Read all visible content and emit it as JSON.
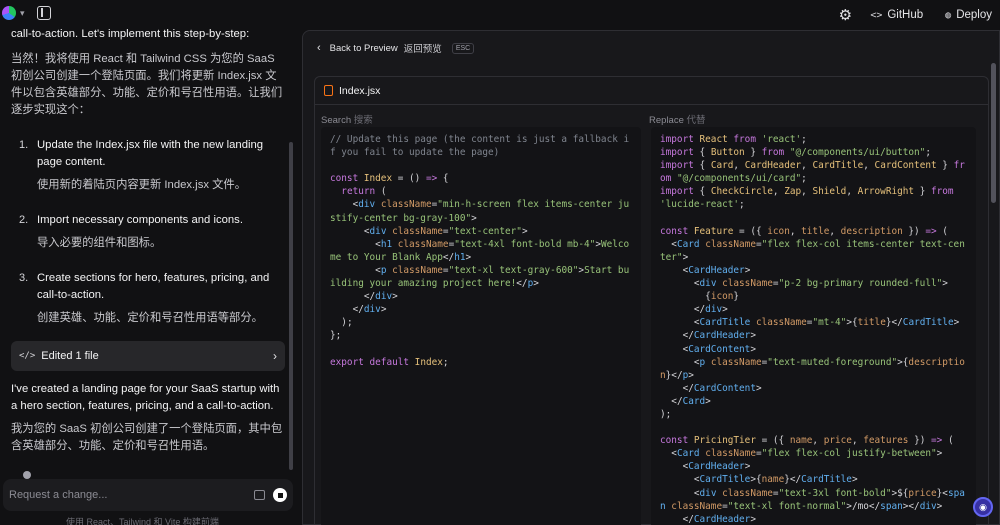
{
  "topbar": {
    "github_label": "GitHub",
    "deploy_label": "Deploy"
  },
  "chat": {
    "intro_en": "call-to-action. Let's implement this step-by-step:",
    "intro_zh": "当然！我将使用 React 和 Tailwind CSS 为您的 SaaS 初创公司创建一个登陆页面。我们将更新 Index.jsx 文件以包含英雄部分、功能、定价和号召性用语。让我们逐步实现这个：",
    "steps": [
      {
        "num": "1.",
        "en": "Update the Index.jsx file with the new landing page content.",
        "zh": "使用新的着陆页内容更新 Index.jsx 文件。"
      },
      {
        "num": "2.",
        "en": "Import necessary components and icons.",
        "zh": "导入必要的组件和图标。"
      },
      {
        "num": "3.",
        "en": "Create sections for hero, features, pricing, and call-to-action.",
        "zh": "创建英雄、功能、定价和号召性用语等部分。"
      }
    ],
    "edited_label": "Edited 1 file",
    "outro_en": "I've created a landing page for your SaaS startup with a hero section, features, pricing, and a call-to-action.",
    "outro_zh": "我为您的 SaaS 初创公司创建了一个登陆页面，其中包含英雄部分、功能、定价和号召性用语。",
    "input_placeholder": "Request a change...",
    "footnote": "使用 React、Tailwind 和 Vite 构建前端"
  },
  "preview": {
    "back_label": "Back to Preview",
    "back_zh": "返回预览",
    "esc_label": "ESC",
    "file_name": "Index.jsx",
    "search_label": "Search",
    "search_zh": "搜索",
    "replace_label": "Replace",
    "replace_zh": "代替",
    "search_code": [
      [
        [
          "c",
          "// Update this page (the content is just a fallback if you fail to update the page)"
        ]
      ],
      [],
      [
        [
          "k",
          "const "
        ],
        [
          "t",
          "Index"
        ],
        [
          "p",
          " = () "
        ],
        [
          "k",
          "=> "
        ],
        [
          "p",
          "{"
        ]
      ],
      [
        [
          "p",
          "  "
        ],
        [
          "k",
          "return "
        ],
        [
          "p",
          "("
        ]
      ],
      [
        [
          "p",
          "    <"
        ],
        [
          "f",
          "div "
        ],
        [
          "a",
          "className"
        ],
        [
          "p",
          "="
        ],
        [
          "s",
          "\"min-h-screen flex items-center justify-center bg-gray-100\""
        ],
        [
          "p",
          ">"
        ]
      ],
      [
        [
          "p",
          "      <"
        ],
        [
          "f",
          "div "
        ],
        [
          "a",
          "className"
        ],
        [
          "p",
          "="
        ],
        [
          "s",
          "\"text-center\""
        ],
        [
          "p",
          ">"
        ]
      ],
      [
        [
          "p",
          "        <"
        ],
        [
          "f",
          "h1 "
        ],
        [
          "a",
          "className"
        ],
        [
          "p",
          "="
        ],
        [
          "s",
          "\"text-4xl font-bold mb-4\""
        ],
        [
          "p",
          ">"
        ],
        [
          "s",
          "Welcome to Your Blank App"
        ],
        [
          "p",
          "</"
        ],
        [
          "f",
          "h1"
        ],
        [
          "p",
          ">"
        ]
      ],
      [
        [
          "p",
          "        <"
        ],
        [
          "f",
          "p "
        ],
        [
          "a",
          "className"
        ],
        [
          "p",
          "="
        ],
        [
          "s",
          "\"text-xl text-gray-600\""
        ],
        [
          "p",
          ">"
        ],
        [
          "s",
          "Start building your amazing project here!"
        ],
        [
          "p",
          "</"
        ],
        [
          "f",
          "p"
        ],
        [
          "p",
          ">"
        ]
      ],
      [
        [
          "p",
          "      </"
        ],
        [
          "f",
          "div"
        ],
        [
          "p",
          ">"
        ]
      ],
      [
        [
          "p",
          "    </"
        ],
        [
          "f",
          "div"
        ],
        [
          "p",
          ">"
        ]
      ],
      [
        [
          "p",
          "  );"
        ]
      ],
      [
        [
          "p",
          "};"
        ]
      ],
      [],
      [
        [
          "k",
          "export default "
        ],
        [
          "t",
          "Index"
        ],
        [
          "p",
          ";"
        ]
      ]
    ],
    "replace_code": [
      [
        [
          "k",
          "import "
        ],
        [
          "t",
          "React "
        ],
        [
          "k",
          "from "
        ],
        [
          "s",
          "'react'"
        ],
        [
          "p",
          ";"
        ]
      ],
      [
        [
          "k",
          "import "
        ],
        [
          "p",
          "{ "
        ],
        [
          "t",
          "Button "
        ],
        [
          "p",
          "} "
        ],
        [
          "k",
          "from "
        ],
        [
          "s",
          "\"@/components/ui/button\""
        ],
        [
          "p",
          ";"
        ]
      ],
      [
        [
          "k",
          "import "
        ],
        [
          "p",
          "{ "
        ],
        [
          "t",
          "Card"
        ],
        [
          "p",
          ", "
        ],
        [
          "t",
          "CardHeader"
        ],
        [
          "p",
          ", "
        ],
        [
          "t",
          "CardTitle"
        ],
        [
          "p",
          ", "
        ],
        [
          "t",
          "CardContent "
        ],
        [
          "p",
          "} "
        ],
        [
          "k",
          "from "
        ],
        [
          "s",
          "\"@/components/ui/card\""
        ],
        [
          "p",
          ";"
        ]
      ],
      [
        [
          "k",
          "import "
        ],
        [
          "p",
          "{ "
        ],
        [
          "t",
          "CheckCircle"
        ],
        [
          "p",
          ", "
        ],
        [
          "t",
          "Zap"
        ],
        [
          "p",
          ", "
        ],
        [
          "t",
          "Shield"
        ],
        [
          "p",
          ", "
        ],
        [
          "t",
          "ArrowRight "
        ],
        [
          "p",
          "} "
        ],
        [
          "k",
          "from "
        ],
        [
          "s",
          "'lucide-react'"
        ],
        [
          "p",
          ";"
        ]
      ],
      [],
      [
        [
          "k",
          "const "
        ],
        [
          "t",
          "Feature"
        ],
        [
          "p",
          " = ({ "
        ],
        [
          "a",
          "icon"
        ],
        [
          "p",
          ", "
        ],
        [
          "a",
          "title"
        ],
        [
          "p",
          ", "
        ],
        [
          "a",
          "description "
        ],
        [
          "p",
          "}) "
        ],
        [
          "k",
          "=> "
        ],
        [
          "p",
          "("
        ]
      ],
      [
        [
          "p",
          "  <"
        ],
        [
          "f",
          "Card "
        ],
        [
          "a",
          "className"
        ],
        [
          "p",
          "="
        ],
        [
          "s",
          "\"flex flex-col items-center text-center\""
        ],
        [
          "p",
          ">"
        ]
      ],
      [
        [
          "p",
          "    <"
        ],
        [
          "f",
          "CardHeader"
        ],
        [
          "p",
          ">"
        ]
      ],
      [
        [
          "p",
          "      <"
        ],
        [
          "f",
          "div "
        ],
        [
          "a",
          "className"
        ],
        [
          "p",
          "="
        ],
        [
          "s",
          "\"p-2 bg-primary rounded-full\""
        ],
        [
          "p",
          ">"
        ]
      ],
      [
        [
          "p",
          "        {"
        ],
        [
          "a",
          "icon"
        ],
        [
          "p",
          "}"
        ]
      ],
      [
        [
          "p",
          "      </"
        ],
        [
          "f",
          "div"
        ],
        [
          "p",
          ">"
        ]
      ],
      [
        [
          "p",
          "      <"
        ],
        [
          "f",
          "CardTitle "
        ],
        [
          "a",
          "className"
        ],
        [
          "p",
          "="
        ],
        [
          "s",
          "\"mt-4\""
        ],
        [
          "p",
          ">{"
        ],
        [
          "a",
          "title"
        ],
        [
          "p",
          "}</"
        ],
        [
          "f",
          "CardTitle"
        ],
        [
          "p",
          ">"
        ]
      ],
      [
        [
          "p",
          "    </"
        ],
        [
          "f",
          "CardHeader"
        ],
        [
          "p",
          ">"
        ]
      ],
      [
        [
          "p",
          "    <"
        ],
        [
          "f",
          "CardContent"
        ],
        [
          "p",
          ">"
        ]
      ],
      [
        [
          "p",
          "      <"
        ],
        [
          "f",
          "p "
        ],
        [
          "a",
          "className"
        ],
        [
          "p",
          "="
        ],
        [
          "s",
          "\"text-muted-foreground\""
        ],
        [
          "p",
          ">{"
        ],
        [
          "a",
          "description"
        ],
        [
          "p",
          "}</"
        ],
        [
          "f",
          "p"
        ],
        [
          "p",
          ">"
        ]
      ],
      [
        [
          "p",
          "    </"
        ],
        [
          "f",
          "CardContent"
        ],
        [
          "p",
          ">"
        ]
      ],
      [
        [
          "p",
          "  </"
        ],
        [
          "f",
          "Card"
        ],
        [
          "p",
          ">"
        ]
      ],
      [
        [
          "p",
          ");"
        ]
      ],
      [],
      [
        [
          "k",
          "const "
        ],
        [
          "t",
          "PricingTier"
        ],
        [
          "p",
          " = ({ "
        ],
        [
          "a",
          "name"
        ],
        [
          "p",
          ", "
        ],
        [
          "a",
          "price"
        ],
        [
          "p",
          ", "
        ],
        [
          "a",
          "features "
        ],
        [
          "p",
          "}) "
        ],
        [
          "k",
          "=> "
        ],
        [
          "p",
          "("
        ]
      ],
      [
        [
          "p",
          "  <"
        ],
        [
          "f",
          "Card "
        ],
        [
          "a",
          "className"
        ],
        [
          "p",
          "="
        ],
        [
          "s",
          "\"flex flex-col justify-between\""
        ],
        [
          "p",
          ">"
        ]
      ],
      [
        [
          "p",
          "    <"
        ],
        [
          "f",
          "CardHeader"
        ],
        [
          "p",
          ">"
        ]
      ],
      [
        [
          "p",
          "      <"
        ],
        [
          "f",
          "CardTitle"
        ],
        [
          "p",
          ">{"
        ],
        [
          "a",
          "name"
        ],
        [
          "p",
          "}</"
        ],
        [
          "f",
          "CardTitle"
        ],
        [
          "p",
          ">"
        ]
      ],
      [
        [
          "p",
          "      <"
        ],
        [
          "f",
          "div "
        ],
        [
          "a",
          "className"
        ],
        [
          "p",
          "="
        ],
        [
          "s",
          "\"text-3xl font-bold\""
        ],
        [
          "p",
          ">${"
        ],
        [
          "a",
          "price"
        ],
        [
          "p",
          "}<"
        ],
        [
          "f",
          "span "
        ],
        [
          "a",
          "className"
        ],
        [
          "p",
          "="
        ],
        [
          "s",
          "\"text-xl font-normal\""
        ],
        [
          "p",
          ">/mo</"
        ],
        [
          "f",
          "span"
        ],
        [
          "p",
          "></"
        ],
        [
          "f",
          "div"
        ],
        [
          "p",
          ">"
        ]
      ],
      [
        [
          "p",
          "    </"
        ],
        [
          "f",
          "CardHeader"
        ],
        [
          "p",
          ">"
        ]
      ]
    ]
  }
}
